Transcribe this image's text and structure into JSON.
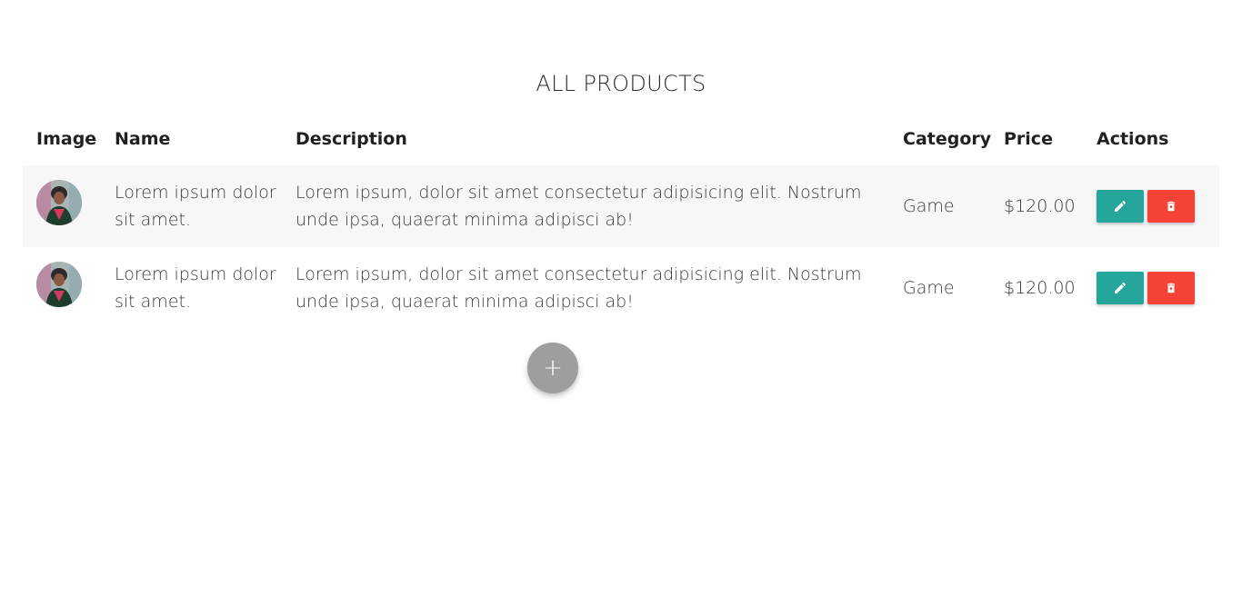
{
  "page": {
    "title": "ALL PRODUCTS"
  },
  "table": {
    "headers": {
      "image": "Image",
      "name": "Name",
      "description": "Description",
      "category": "Category",
      "price": "Price",
      "actions": "Actions"
    },
    "rows": [
      {
        "image_icon": "product-avatar",
        "name": "Lorem ipsum dolor sit amet.",
        "description": "Lorem ipsum, dolor sit amet consectetur adipisicing elit. Nostrum unde ipsa, quaerat minima adipisci ab!",
        "category": "Game",
        "price": "$120.00",
        "edit_icon": "pencil-icon",
        "delete_icon": "trash-icon"
      },
      {
        "image_icon": "product-avatar",
        "name": "Lorem ipsum dolor sit amet.",
        "description": "Lorem ipsum, dolor sit amet consectetur adipisicing elit. Nostrum unde ipsa, quaerat minima adipisci ab!",
        "category": "Game",
        "price": "$120.00",
        "edit_icon": "pencil-icon",
        "delete_icon": "trash-icon"
      }
    ]
  },
  "fab": {
    "label": "+",
    "icon": "plus-icon"
  },
  "colors": {
    "edit_button": "#26a69a",
    "delete_button": "#f44336",
    "fab": "#9e9e9e",
    "row_stripe": "#f7f7f7"
  }
}
